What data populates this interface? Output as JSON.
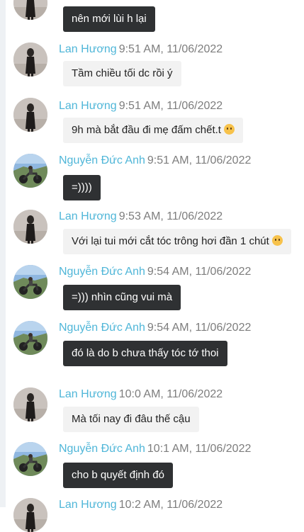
{
  "messages": [
    {
      "sender": "",
      "time": "",
      "text": "nên mới lùi h lại",
      "style": "dark",
      "avatar": "lan"
    },
    {
      "sender": "Lan Hương",
      "time": "9:51 AM, 11/06/2022",
      "text": "Tầm chiều tối dc rồi ý",
      "style": "light",
      "avatar": "lan"
    },
    {
      "sender": "Lan Hương",
      "time": "9:51 AM, 11/06/2022",
      "text": "9h mà bắt đầu đi mẹ đấm chết.t",
      "emoji": "worried-face",
      "style": "light",
      "avatar": "lan"
    },
    {
      "sender": "Nguyễn Đức Anh",
      "time": "9:51 AM, 11/06/2022",
      "text": "=))))",
      "style": "dark",
      "avatar": "anh"
    },
    {
      "sender": "Lan Hương",
      "time": "9:53 AM, 11/06/2022",
      "text": "Với lại tui mới cắt tóc trông hơi đần 1 chút",
      "emoji": "sad-face",
      "style": "light",
      "avatar": "lan"
    },
    {
      "sender": "Nguyễn Đức Anh",
      "time": "9:54 AM, 11/06/2022",
      "text": "=))) nhìn cũng vui mà",
      "style": "dark",
      "avatar": "anh"
    },
    {
      "sender": "Nguyễn Đức Anh",
      "time": "9:54 AM, 11/06/2022",
      "text": "đó là do b chưa thấy tóc tớ thoi",
      "style": "dark",
      "avatar": "anh"
    },
    {
      "sender": "Lan Hương",
      "time": "10:0 AM, 11/06/2022",
      "text": "Mà tối nay đi đâu thế cậu",
      "style": "light",
      "avatar": "lan"
    },
    {
      "sender": "Nguyễn Đức Anh",
      "time": "10:1 AM, 11/06/2022",
      "text": "cho b quyết định đó",
      "style": "dark",
      "avatar": "anh"
    },
    {
      "sender": "Lan Hương",
      "time": "10:2 AM, 11/06/2022",
      "text": "",
      "style": "light",
      "avatar": "lan"
    }
  ]
}
